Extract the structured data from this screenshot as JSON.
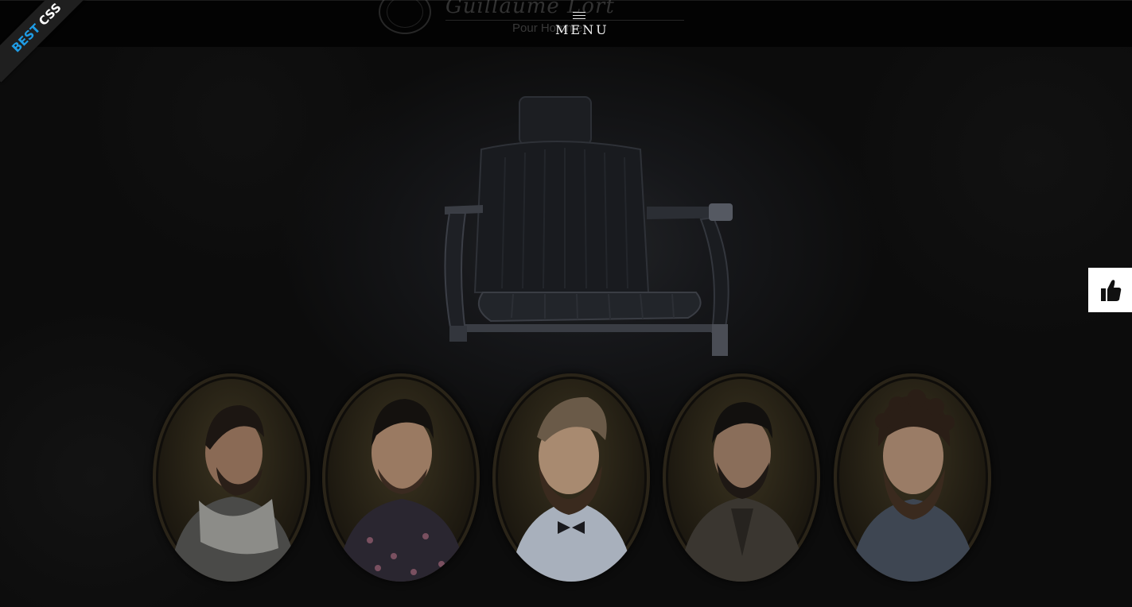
{
  "header": {
    "logo_script": "Guillaume Lort",
    "logo_subtitle": "Pour Homme",
    "menu_label": "MENU"
  },
  "ribbon": {
    "word1": "BEST",
    "word2": "CSS",
    "colors": {
      "word1": "#1f9ce5",
      "word2": "#ffffff"
    }
  },
  "like_tab": {
    "icon": "thumbs-up-icon"
  },
  "portraits": [
    {
      "id": "barber-1",
      "icon": "portrait-profile-scarf",
      "palette": {
        "skin": "#8a6a55",
        "hair": "#1c1612",
        "beard": "#2a1f18",
        "clothes": "#4a4a48"
      }
    },
    {
      "id": "barber-2",
      "icon": "portrait-floral-shirt",
      "palette": {
        "skin": "#9a7a62",
        "hair": "#14110e",
        "beard": "#3a2a20",
        "clothes": "#2a2630"
      }
    },
    {
      "id": "barber-3",
      "icon": "portrait-bowtie",
      "palette": {
        "skin": "#a88a70",
        "hair": "#6a5a48",
        "beard": "#3a2a1e",
        "clothes": "#a8b0bc"
      }
    },
    {
      "id": "barber-4",
      "icon": "portrait-suit",
      "palette": {
        "skin": "#8a6e5a",
        "hair": "#12100e",
        "beard": "#1e1814",
        "clothes": "#3a3630"
      }
    },
    {
      "id": "barber-5",
      "icon": "portrait-curly-beard",
      "palette": {
        "skin": "#9a7c66",
        "hair": "#2a1e16",
        "beard": "#3a2a1e",
        "clothes": "#3e4652"
      }
    }
  ]
}
